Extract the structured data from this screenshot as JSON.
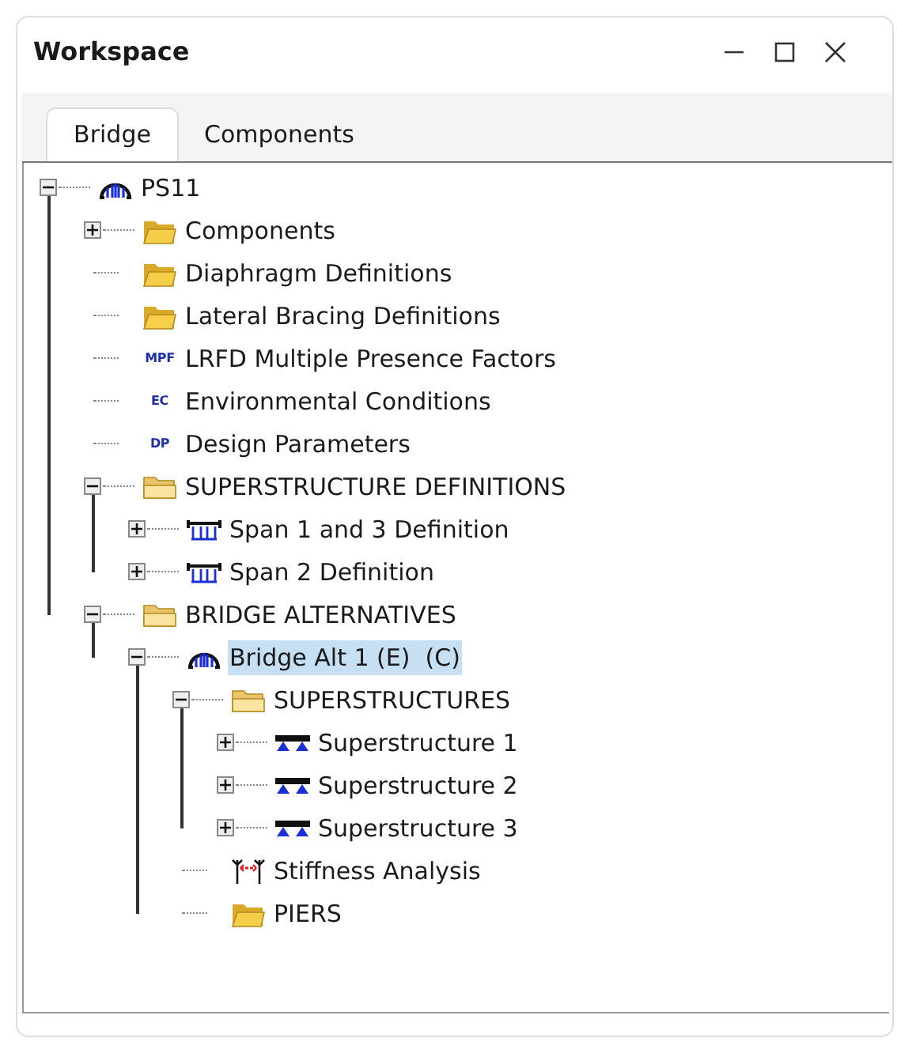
{
  "window": {
    "title": "Workspace"
  },
  "tabs": [
    {
      "label": "Bridge",
      "selected": true
    },
    {
      "label": "Components",
      "selected": false
    }
  ],
  "tree": [
    {
      "label": "PS11",
      "kind": "bridge",
      "expanded": true,
      "selected": false,
      "children": [
        {
          "label": "Components",
          "kind": "folder",
          "expanded": false,
          "selected": false
        },
        {
          "label": "Diaphragm Definitions",
          "kind": "folder",
          "selected": false
        },
        {
          "label": "Lateral Bracing Definitions",
          "kind": "folder",
          "selected": false
        },
        {
          "label": "LRFD Multiple Presence Factors",
          "kind": "code",
          "badge": "MPF",
          "selected": false
        },
        {
          "label": "Environmental Conditions",
          "kind": "code",
          "badge": "EC",
          "selected": false
        },
        {
          "label": "Design Parameters",
          "kind": "code",
          "badge": "DP",
          "selected": false
        },
        {
          "label": "SUPERSTRUCTURE DEFINITIONS",
          "kind": "open-folder",
          "expanded": true,
          "selected": false,
          "children": [
            {
              "label": "Span 1 and 3 Definition",
              "kind": "span",
              "expanded": false,
              "selected": false
            },
            {
              "label": "Span 2 Definition",
              "kind": "span",
              "expanded": false,
              "selected": false
            }
          ]
        },
        {
          "label": "BRIDGE ALTERNATIVES",
          "kind": "open-folder",
          "expanded": true,
          "selected": false,
          "children": [
            {
              "label": "Bridge Alt 1 (E)  (C)",
              "kind": "bridge",
              "expanded": true,
              "selected": true,
              "children": [
                {
                  "label": "SUPERSTRUCTURES",
                  "kind": "open-folder",
                  "expanded": true,
                  "selected": false,
                  "children": [
                    {
                      "label": "Superstructure 1",
                      "kind": "superstructure",
                      "expanded": false,
                      "selected": false
                    },
                    {
                      "label": "Superstructure 2",
                      "kind": "superstructure",
                      "expanded": false,
                      "selected": false
                    },
                    {
                      "label": "Superstructure 3",
                      "kind": "superstructure",
                      "expanded": false,
                      "selected": false
                    }
                  ]
                },
                {
                  "label": "Stiffness Analysis",
                  "kind": "stiffness",
                  "selected": false
                },
                {
                  "label": "PIERS",
                  "kind": "folder",
                  "selected": false
                }
              ]
            }
          ]
        }
      ]
    }
  ]
}
